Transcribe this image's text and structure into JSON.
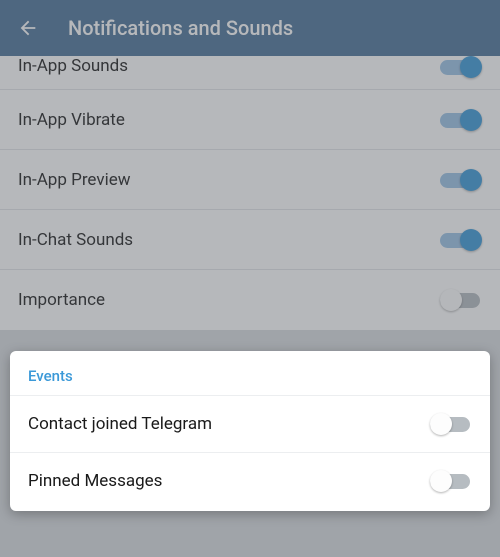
{
  "header": {
    "title": "Notifications and Sounds"
  },
  "background_settings": [
    {
      "label": "In-App Sounds",
      "on": true
    },
    {
      "label": "In-App Vibrate",
      "on": true
    },
    {
      "label": "In-App Preview",
      "on": true
    },
    {
      "label": "In-Chat Sounds",
      "on": true
    },
    {
      "label": "Importance",
      "on": false
    }
  ],
  "events": {
    "section_title": "Events",
    "items": [
      {
        "label": "Contact joined Telegram",
        "on": false
      },
      {
        "label": "Pinned Messages",
        "on": false
      }
    ]
  }
}
